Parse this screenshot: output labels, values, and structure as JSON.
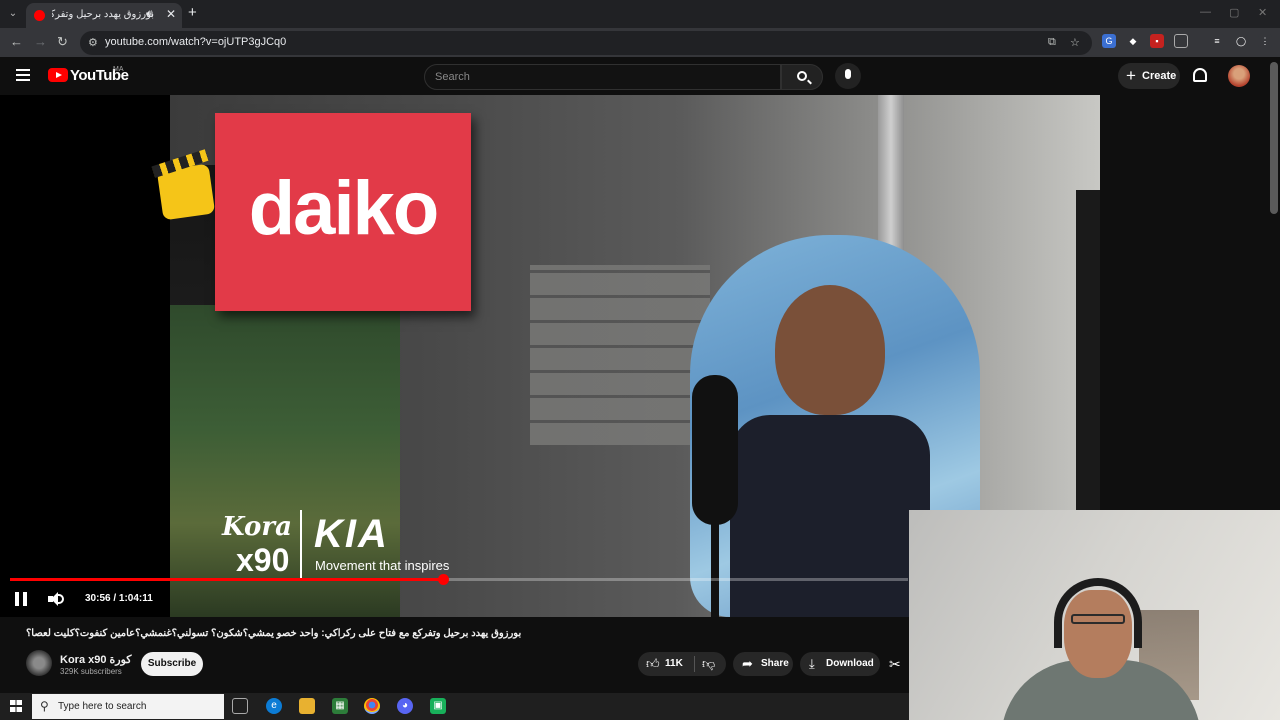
{
  "browser": {
    "tab_title": "بورزوق يهدد برحيل وتفركع مع",
    "url": "youtube.com/watch?v=ojUTP3gJCq0",
    "icons": [
      "tab-list-icon",
      "youtube-favicon",
      "audio-icon",
      "close-icon",
      "plus-icon",
      "back-icon",
      "forward-icon",
      "reload-icon",
      "site-info-icon",
      "cast-icon",
      "star-icon",
      "translate-icon",
      "extension-icon",
      "puzzle-icon",
      "media-icon",
      "profile-icon",
      "kebab-icon"
    ]
  },
  "youtube": {
    "logo_text": "YouTube",
    "country_code": "MA",
    "search_placeholder": "Search",
    "create_label": "Create"
  },
  "player": {
    "time_display": "30:56 / 1:04:11",
    "progress": 0.482,
    "overlay": {
      "sign_text": "daiko",
      "kora_text": "Kora",
      "kora_number": "x90",
      "kia_logo": "KIA",
      "kia_tagline": "Movement that inspires"
    }
  },
  "video": {
    "title": "بورزوق يهدد برحيل وتفركع مع فتاح على ركراكي: واحد خصو يمشي؟شكون؟ تسولني؟غنمشي؟عامين كنفوت؟كليت لعصا؟",
    "channel_name": "Kora x90 كورة",
    "subscribers": "329K subscribers",
    "subscribe_label": "Subscribe",
    "likes": "11K",
    "share_label": "Share",
    "download_label": "Download"
  },
  "taskbar": {
    "search_placeholder": "Type here to search"
  },
  "colors": {
    "accent": "#ff0000",
    "background": "#0f0f0f"
  }
}
